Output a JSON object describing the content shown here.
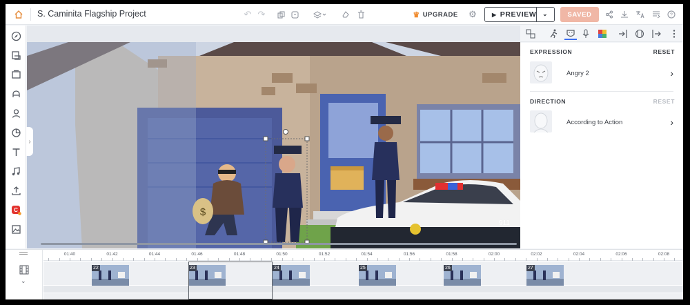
{
  "topbar": {
    "project_title": "S. Caminita Flagship Project",
    "upgrade_label": "UPGRADE",
    "preview_label": "PREVIEW",
    "saved_label": "SAVED"
  },
  "right_panel": {
    "expression": {
      "heading": "EXPRESSION",
      "reset": "RESET",
      "value": "Angry 2"
    },
    "direction": {
      "heading": "DIRECTION",
      "reset": "RESET",
      "value": "According to Action"
    }
  },
  "timeline": {
    "ticks": [
      "01:40",
      "01:42",
      "01:44",
      "01:46",
      "01:48",
      "01:50",
      "01:52",
      "01:54",
      "01:56",
      "01:58",
      "02:00",
      "02:02",
      "02:04",
      "02:06",
      "02:08"
    ],
    "scenes": [
      "22",
      "23",
      "24",
      "25",
      "26",
      "27"
    ]
  },
  "scene": {
    "car_number": "911"
  },
  "colors": {
    "accent": "#e58b3a",
    "saved_bg": "#f0b7a6",
    "panel_active": "#3b6df0"
  }
}
